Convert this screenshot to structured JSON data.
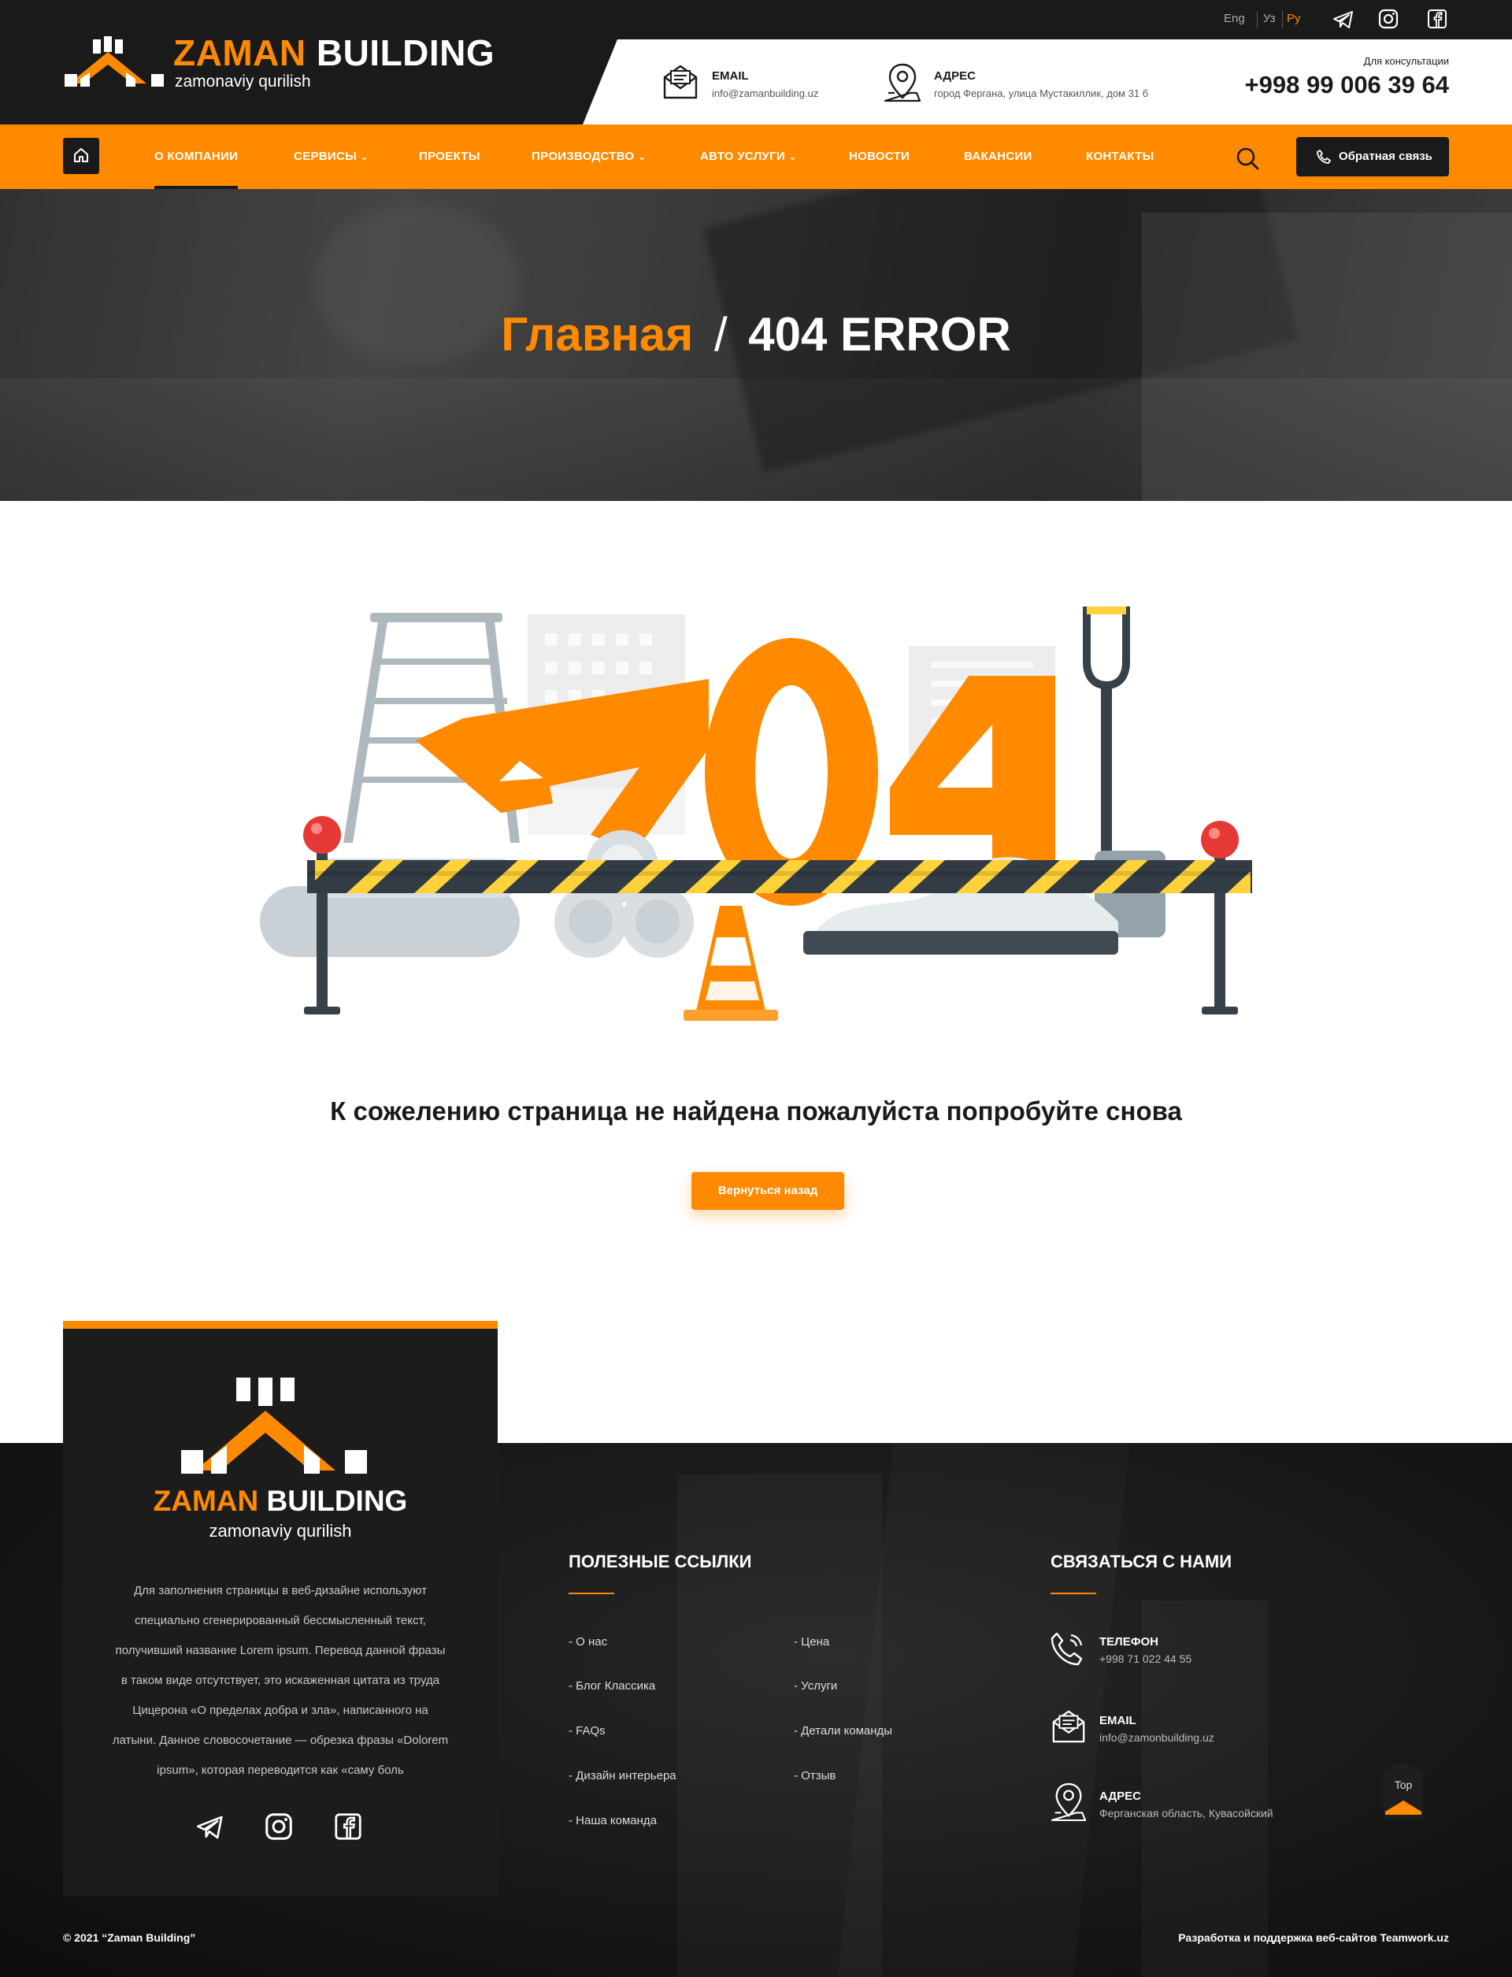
{
  "brand": {
    "name_part1": "ZAMAN",
    "name_part2": "BUILDING",
    "tagline": "zamonaviy qurilish"
  },
  "languages": [
    "Eng",
    "Уз",
    "Ру"
  ],
  "active_language": "Ру",
  "header_contacts": {
    "email_label": "EMAIL",
    "email_value": "info@zamanbuilding.uz",
    "address_label": "АДРЕС",
    "address_value": "город Фергана, улица Мустакиллик, дом 31 б",
    "consult_label": "Для консультации",
    "phone": "+998 99 006 39 64"
  },
  "nav": {
    "items": [
      {
        "label": "О КОМПАНИИ"
      },
      {
        "label": "СЕРВИСЫ"
      },
      {
        "label": "ПРОЕКТЫ"
      },
      {
        "label": "ПРОИЗВОДСТВО"
      },
      {
        "label": "АВТО УСЛУГИ"
      },
      {
        "label": "НОВОСТИ"
      },
      {
        "label": "ВАКАНСИИ"
      },
      {
        "label": "КОНТАКТЫ"
      }
    ],
    "callback_label": "Обратная связь"
  },
  "banner": {
    "crumb_home": "Главная",
    "separator": "/",
    "crumb_current": "404 ERROR"
  },
  "error": {
    "illustration_text": "404",
    "message": "К сожелению страница не найдена пожалуйста попробуйте снова",
    "back_label": "Вернуться назад"
  },
  "footer": {
    "about_text": "Для заполнения страницы в веб-дизайне используют специально сгенерированный бессмысленный текст, получивший название Lorem ipsum. Перевод данной фразы в таком виде отсутствует, это искаженная цитата из труда Цицерона «О пределах добра и зла», написанного на латыни. Данное словосочетание — обрезка фразы «Dolorem ipsum», которая переводится как «саму боль",
    "about_lines": [
      "Для заполнения страницы в веб-дизайне используют",
      "специально сгенерированный бессмысленный текст,",
      "получивший название Lorem ipsum. Перевод данной фразы",
      "в таком виде отсутствует, это искаженная цитата из труда",
      "Цицерона «О пределах добра и зла», написанного на",
      "латыни. Данное словосочетание — обрезка фразы «Dolorem",
      "ipsum», которая переводится как «саму боль"
    ],
    "links_heading": "ПОЛЕЗНЫЕ ССЫЛКИ",
    "links_col1": [
      "- О нас",
      "- Блог Классика",
      "- FAQs",
      "- Дизайн интерьера",
      "- Наша команда"
    ],
    "links_col2": [
      "- Цена",
      "- Услуги",
      "- Детали команды",
      "- Отзыв"
    ],
    "contact_heading": "СВЯЗАТЬСЯ С НАМИ",
    "contacts": [
      {
        "title": "ТЕЛЕФОН",
        "value": "+998 71 022 44 55"
      },
      {
        "title": "EMAIL",
        "value": "info@zamonbuilding.uz"
      },
      {
        "title": "АДРЕС",
        "value": "Ферганская область, Кувасойский"
      }
    ],
    "top_label": "Top",
    "copyright": "© 2021 “Zaman Building”",
    "developer": "Разработка и поддержка веб-сайтов Teamwork.uz"
  },
  "colors": {
    "accent": "#ff8a00",
    "dark": "#1a1a1a",
    "text": "#1a1a1a"
  },
  "icons": [
    "home-icon",
    "search-icon",
    "phone-icon",
    "telegram-icon",
    "instagram-icon",
    "facebook-icon",
    "email-icon",
    "location-icon",
    "chevron-down-icon",
    "arrow-up-icon"
  ]
}
